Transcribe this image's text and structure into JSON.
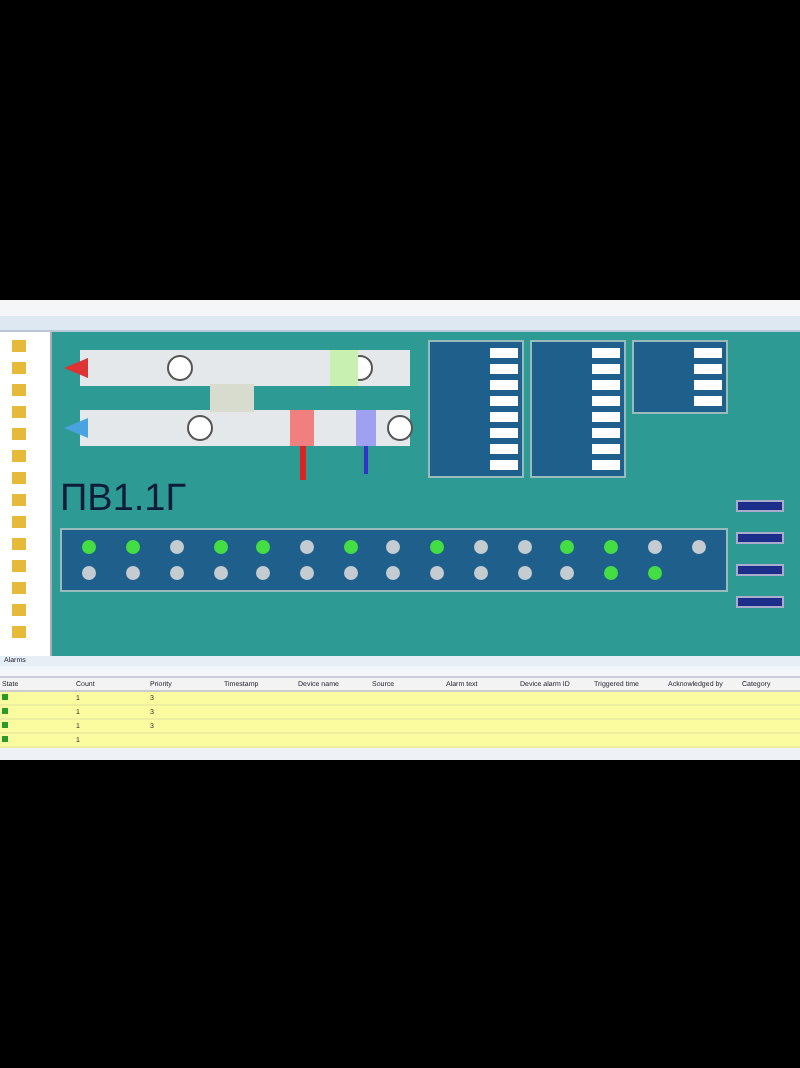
{
  "title": "ПВ1.1Г",
  "lamps": [
    {
      "on": true
    },
    {
      "on": true
    },
    {
      "on": false
    },
    {
      "on": true
    },
    {
      "on": true
    },
    {
      "on": false
    },
    {
      "on": true
    },
    {
      "on": false
    },
    {
      "on": true
    },
    {
      "on": false
    },
    {
      "on": false
    },
    {
      "on": true
    },
    {
      "on": true
    },
    {
      "on": false
    },
    {
      "on": false
    },
    {
      "on": false
    },
    {
      "on": false
    },
    {
      "on": false
    },
    {
      "on": false
    },
    {
      "on": false
    },
    {
      "on": false
    },
    {
      "on": false
    },
    {
      "on": false
    },
    {
      "on": false
    },
    {
      "on": false
    },
    {
      "on": false
    },
    {
      "on": false
    },
    {
      "on": true
    },
    {
      "on": true
    }
  ],
  "alarms": {
    "title": "Alarms",
    "columns": [
      "State",
      "Count",
      "Priority",
      "Timestamp",
      "Device name",
      "Source",
      "Alarm text",
      "Device alarm ID",
      "Triggered time",
      "Acknowledged by",
      "Category"
    ],
    "rows": [
      {
        "acknowledged": true,
        "count": "1",
        "priority": "3"
      },
      {
        "acknowledged": true,
        "count": "1",
        "priority": "3"
      },
      {
        "acknowledged": true,
        "count": "1",
        "priority": "3"
      },
      {
        "acknowledged": true,
        "count": "1"
      }
    ]
  }
}
